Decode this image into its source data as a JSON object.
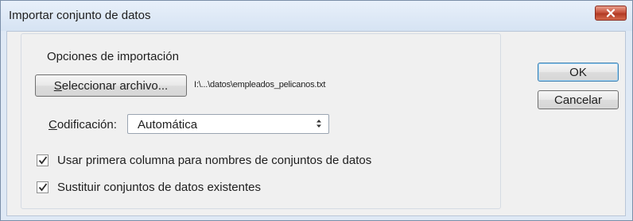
{
  "window": {
    "title": "Importar conjunto de datos",
    "close_icon": "close-icon"
  },
  "group": {
    "legend": "Opciones de importación",
    "select_file": {
      "mnemonic": "S",
      "rest": "eleccionar archivo..."
    },
    "file_path": "I:\\...\\datos\\empleados_pelicanos.txt",
    "encoding": {
      "label_mnemonic": "C",
      "label_rest": "odificación:",
      "value": "Automática"
    },
    "options": [
      {
        "label": "Usar primera columna para nombres de conjuntos de datos",
        "checked": true
      },
      {
        "label": "Sustituir conjuntos de datos existentes",
        "checked": true
      }
    ]
  },
  "buttons": {
    "ok": "OK",
    "cancel": "Cancelar"
  },
  "colors": {
    "titlebar": "#d6e3f3",
    "client": "#f0f0f0",
    "close": "#c8553f"
  }
}
